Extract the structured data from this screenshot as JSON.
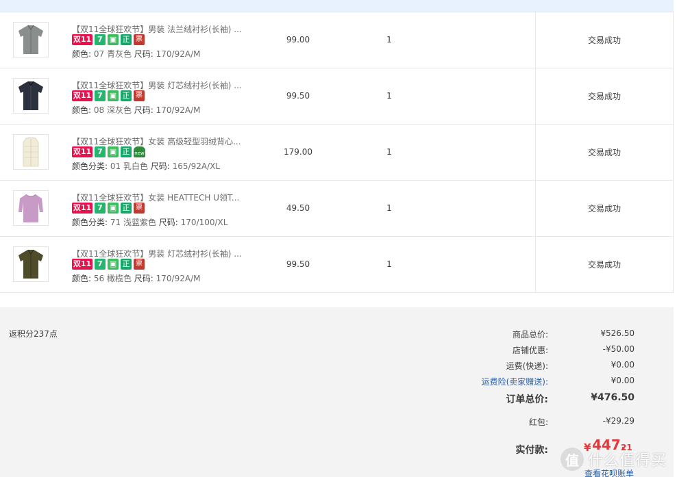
{
  "items": [
    {
      "title": "【双11全球狂欢节】男装 法兰绒衬衫(长袖) ...",
      "badges": [
        "双11",
        "7",
        "付",
        "正",
        "票"
      ],
      "attr_label": "颜色: ",
      "attr_value": "07 青灰色",
      "size_label": "尺码: ",
      "size_value": "170/92A/M",
      "price": "99.00",
      "qty": "1",
      "status": "交易成功",
      "swatch_color": "#8a8e8c"
    },
    {
      "title": "【双11全球狂欢节】男装 灯芯绒衬衫(长袖) ...",
      "badges": [
        "双11",
        "7",
        "付",
        "正",
        "票"
      ],
      "attr_label": "颜色: ",
      "attr_value": "08 深灰色",
      "size_label": "尺码: ",
      "size_value": "170/92A/M",
      "price": "99.50",
      "qty": "1",
      "status": "交易成功",
      "swatch_color": "#2c3140"
    },
    {
      "title": "【双11全球狂欢节】女装 高级轻型羽绒背心...",
      "badges": [
        "双11",
        "7",
        "付",
        "正",
        "new"
      ],
      "attr_label": "颜色分类: ",
      "attr_value": "01 乳白色",
      "size_label": "尺码: ",
      "size_value": "165/92A/XL",
      "price": "179.00",
      "qty": "1",
      "status": "交易成功",
      "swatch_color": "#f1ecd8"
    },
    {
      "title": "【双11全球狂欢节】女装 HEATTECH U领T...",
      "badges": [
        "双11",
        "7",
        "付",
        "正",
        "票"
      ],
      "attr_label": "颜色分类: ",
      "attr_value": "71 浅蓝紫色",
      "size_label": "尺码: ",
      "size_value": "170/100/XL",
      "price": "49.50",
      "qty": "1",
      "status": "交易成功",
      "swatch_color": "#c79bc6"
    },
    {
      "title": "【双11全球狂欢节】男装 灯芯绒衬衫(长袖) ...",
      "badges": [
        "双11",
        "7",
        "付",
        "正",
        "票"
      ],
      "attr_label": "颜色: ",
      "attr_value": "56 橄榄色",
      "size_label": "尺码: ",
      "size_value": "170/92A/M",
      "price": "99.50",
      "qty": "1",
      "status": "交易成功",
      "swatch_color": "#4f4c2c"
    }
  ],
  "summary": {
    "points": "返积分237点",
    "goods_total_label": "商品总价:",
    "goods_total": "¥526.50",
    "shop_discount_label": "店铺优惠:",
    "shop_discount": "-¥50.00",
    "shipping_label": "运费(快递):",
    "shipping": "¥0.00",
    "shipping_insurance_label": "运费险(卖家赠送):",
    "shipping_insurance": "¥0.00",
    "order_total_label": "订单总价:",
    "order_total": "¥476.50",
    "red_packet_label": "红包:",
    "red_packet": "-¥29.29",
    "paid_label": "实付款:",
    "paid_yen": "¥",
    "paid_int": "447.",
    "paid_dec": "21",
    "bill_link": "查看花呗账单"
  },
  "watermark": {
    "logo": "值",
    "text": "什么值得买"
  },
  "colors": {
    "accent_red": "#e4393c",
    "link_blue": "#2b5ea6",
    "header_strip": "#e8f2ff",
    "summary_bg": "#f3f3f3"
  }
}
